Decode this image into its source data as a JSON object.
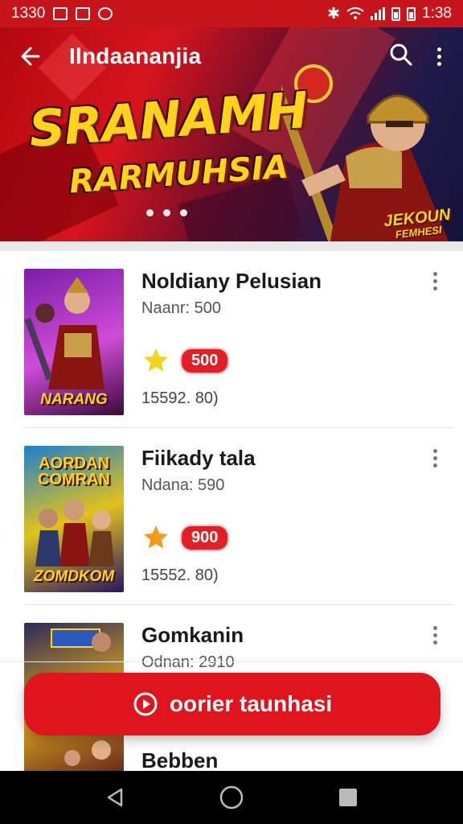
{
  "status_bar": {
    "time_left": "1330",
    "time_right": "1:38"
  },
  "header": {
    "title": "Ilndaananjia"
  },
  "banner": {
    "headline": "SRANAMH",
    "subheadline": "RARMUHSIA",
    "badge_line1": "JEKOUN",
    "badge_line2": "FEMHESI",
    "dots": 3
  },
  "games": [
    {
      "title": "Noldiany Pelusian",
      "subtitle": "Naanr: 500",
      "badge": "500",
      "meta": "15592. 80)",
      "star_color": "#f6d21a",
      "thumb_label": "NARANG",
      "thumb_top": "",
      "thumb_colors": [
        "#7a1fa8",
        "#d04bd8",
        "#3a0b3a"
      ]
    },
    {
      "title": "Fiikady tala",
      "subtitle": "Ndana: 590",
      "badge": "900",
      "meta": "15552. 80)",
      "star_color": "#f39a1c",
      "thumb_label": "ZOMDKOM",
      "thumb_top": "AORDAN COMRAN",
      "thumb_colors": [
        "#1c7fd0",
        "#e2c21b",
        "#2a1560"
      ]
    },
    {
      "title": "Gomkanin",
      "subtitle": "Odnan: 2910",
      "thumb_label": "",
      "thumb_top": "",
      "thumb_colors": [
        "#2b2a5a",
        "#d8a21f",
        "#5a1a1a"
      ]
    },
    {
      "title": "Bebben"
    }
  ],
  "cta": {
    "label": "oorier taunhasi"
  },
  "nav": {
    "back": "back-icon",
    "home": "home-icon",
    "recents": "recents-icon"
  }
}
